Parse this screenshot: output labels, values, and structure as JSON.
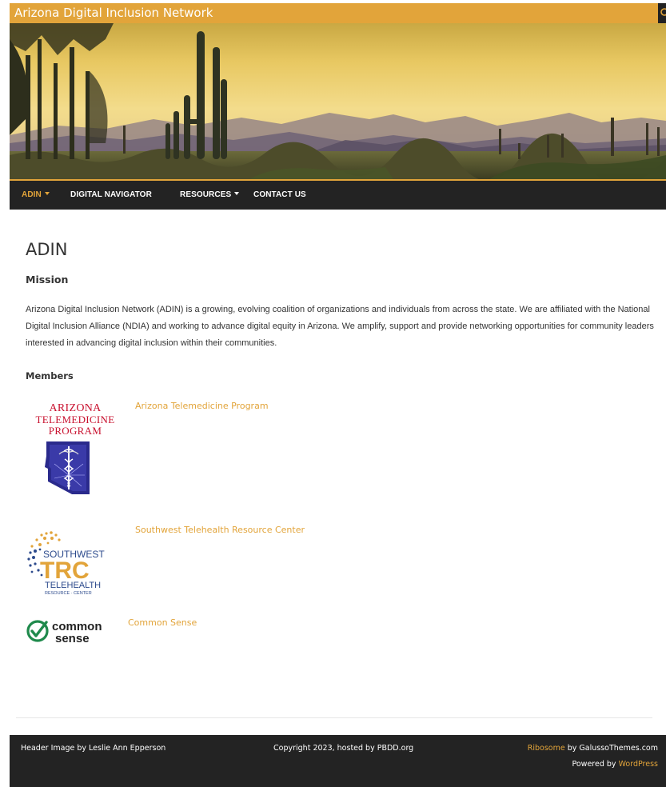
{
  "site": {
    "title": "Arizona Digital Inclusion Network",
    "search_icon": "search-icon"
  },
  "nav": {
    "items": [
      {
        "label": "ADIN",
        "active": true,
        "has_dropdown": true
      },
      {
        "label": "DIGITAL NAVIGATOR",
        "active": false,
        "has_dropdown": false
      },
      {
        "label": "RESOURCES",
        "active": false,
        "has_dropdown": true
      },
      {
        "label": "CONTACT US",
        "active": false,
        "has_dropdown": false
      }
    ]
  },
  "page": {
    "title": "ADIN",
    "mission_heading": "Mission",
    "mission_text": "Arizona Digital Inclusion Network (ADIN) is a growing, evolving coalition of organizations and individuals from across the state. We are affiliated with the National Digital Inclusion Alliance (NDIA) and working to advance digital equity in Arizona. We amplify, support and provide networking opportunities for community leaders interested in advancing digital inclusion within their communities.",
    "members_heading": "Members"
  },
  "members": [
    {
      "name": "Arizona Telemedicine Program",
      "logo_lines": [
        "ARIZONA",
        "TELEMEDICINE",
        "PROGRAM"
      ]
    },
    {
      "name": "Southwest Telehealth Resource Center",
      "logo_lines": [
        "SOUTHWEST",
        "TRC",
        "TELEHEALTH",
        "RESOURCE · CENTER"
      ]
    },
    {
      "name": "Common Sense",
      "logo_lines": [
        "common",
        "sense"
      ]
    }
  ],
  "footer": {
    "left": "Header Image by Leslie Ann Epperson",
    "center": "Copyright 2023, hosted by PBDD.org",
    "theme_link": "Ribosome",
    "theme_by": " by GalussoThemes.com",
    "powered_by": "Powered by ",
    "wordpress_link": "WordPress"
  },
  "colors": {
    "accent": "#e2a43a",
    "nav_bg": "#232323",
    "footer_bg": "#232323"
  }
}
